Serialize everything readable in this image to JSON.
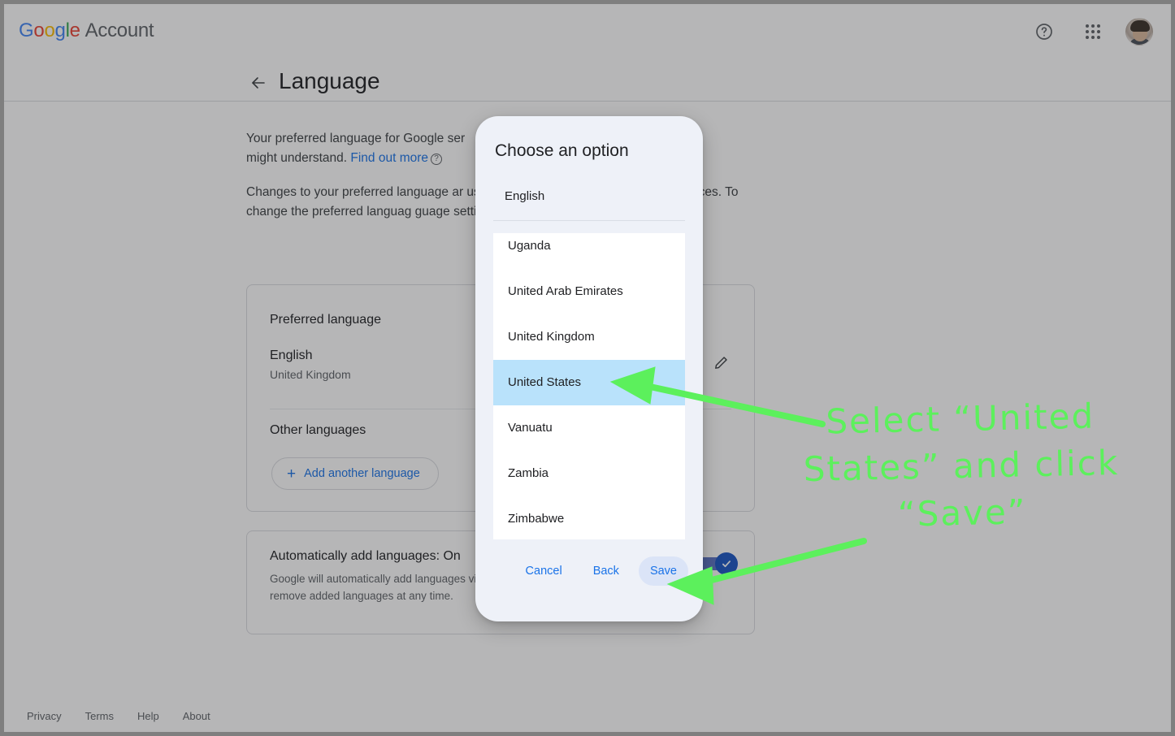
{
  "header": {
    "brand_google": "Google",
    "brand_word": "Account",
    "help_icon": "help-circle-icon",
    "apps_icon": "apps-grid-icon",
    "avatar_icon": "user-avatar"
  },
  "title_row": {
    "back_icon": "back-arrow-icon",
    "title": "Language"
  },
  "intro": {
    "paragraph1_a": "Your preferred language for Google ser",
    "paragraph1_b": "might understand. ",
    "find_out_more": "Find out more",
    "help_badge": "?",
    "paragraph2": "Changes to your preferred language ar use your language info to show you mo vices. To change the preferred languag guage settings on your device."
  },
  "languages_card": {
    "preferred_title": "Preferred language",
    "preferred_language": "English",
    "preferred_region": "United Kingdom",
    "edit_icon": "pencil-edit-icon",
    "other_title": "Other languages",
    "add_button_plus": "+",
    "add_button_label": "Add another language"
  },
  "auto_card": {
    "title": "Automatically add languages: On",
    "description": "Google will automatically add languages vices. You might see content in these lan remove added languages at any time.",
    "toggle_state": "On",
    "toggle_icon": "check-icon"
  },
  "footer": {
    "links": [
      "Privacy",
      "Terms",
      "Help",
      "About"
    ]
  },
  "dialog": {
    "title": "Choose an option",
    "language_label": "English",
    "items": [
      "Uganda",
      "United Arab Emirates",
      "United Kingdom",
      "United States",
      "Vanuatu",
      "Zambia",
      "Zimbabwe"
    ],
    "selected_item": "United States",
    "buttons": {
      "cancel": "Cancel",
      "back": "Back",
      "save": "Save"
    }
  },
  "annotation": {
    "line1": "Select “United",
    "line2": "States” and click",
    "line3": "“Save”",
    "color": "#5cf05c",
    "arrow1_target": "united-states-list-item",
    "arrow2_target": "save-button"
  }
}
